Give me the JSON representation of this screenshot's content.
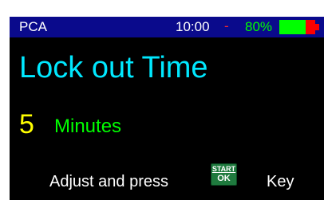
{
  "status_bar": {
    "title": "PCA",
    "time": "10:00",
    "separator": "-",
    "battery_percent_text": "80%",
    "battery_level": 0.8,
    "battery_colors": {
      "charged": "#00ff00",
      "empty": "#ff0000"
    }
  },
  "screen": {
    "heading": "Lock out Time",
    "value": "5",
    "unit": "Minutes",
    "instruction_prefix": "Adjust and press",
    "instruction_suffix": "Key"
  },
  "start_ok_key": {
    "top_label": "START",
    "bottom_label": "OK",
    "icon": "start-ok-key-icon"
  },
  "colors": {
    "status_bar_bg": "#0a0a8c",
    "heading": "#00e8ff",
    "value": "#ffff00",
    "unit": "#00ff00",
    "key_bg": "#1f7a3e"
  }
}
